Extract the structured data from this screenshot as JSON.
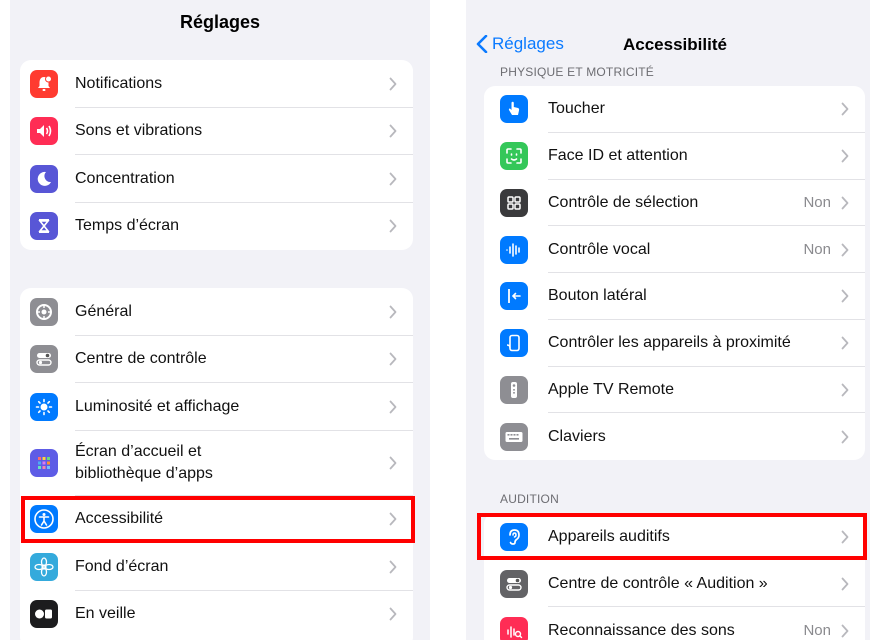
{
  "left": {
    "title": "Réglages",
    "group1": [
      {
        "label": "Notifications",
        "icon": "notifications-bell-icon",
        "color": "#ff3b30"
      },
      {
        "label": "Sons et vibrations",
        "icon": "speaker-sound-icon",
        "color": "#ff2d55"
      },
      {
        "label": "Concentration",
        "icon": "moon-icon",
        "color": "#5856d6"
      },
      {
        "label": "Temps d’écran",
        "icon": "hourglass-icon",
        "color": "#5856d6"
      }
    ],
    "group2": [
      {
        "label": "Général",
        "icon": "gear-icon",
        "color": "#8e8e93"
      },
      {
        "label": "Centre de contrôle",
        "icon": "toggles-icon",
        "color": "#8e8e93"
      },
      {
        "label": "Luminosité et affichage",
        "icon": "sun-icon",
        "color": "#007aff"
      },
      {
        "label": "Écran d’accueil et",
        "label2": "bibliothèque d’apps",
        "icon": "app-grid-icon",
        "color": "#5e5ce6"
      },
      {
        "label": "Accessibilité",
        "icon": "accessibility-person-icon",
        "color": "#007aff",
        "highlighted": true
      },
      {
        "label": "Fond d’écran",
        "icon": "flower-icon",
        "color": "#34aadc"
      },
      {
        "label": "En veille",
        "icon": "standby-icon",
        "color": "#1c1c1e"
      }
    ]
  },
  "right": {
    "back_label": "Réglages",
    "title": "Accessibilité",
    "section1": "PHYSIQUE ET MOTRICITÉ",
    "group1": [
      {
        "label": "Toucher",
        "icon": "hand-touch-icon",
        "color": "#007aff"
      },
      {
        "label": "Face ID et attention",
        "icon": "face-id-icon",
        "color": "#34c759"
      },
      {
        "label": "Contrôle de sélection",
        "value": "Non",
        "icon": "switch-grid-icon",
        "color": "#3a3a3c"
      },
      {
        "label": "Contrôle vocal",
        "value": "Non",
        "icon": "voice-wave-icon",
        "color": "#007aff"
      },
      {
        "label": "Bouton latéral",
        "icon": "side-button-icon",
        "color": "#007aff"
      },
      {
        "label": "Contrôler les appareils à proximité",
        "icon": "nearby-device-icon",
        "color": "#007aff"
      },
      {
        "label": "Apple TV Remote",
        "icon": "tv-remote-icon",
        "color": "#8e8e93"
      },
      {
        "label": "Claviers",
        "icon": "keyboard-icon",
        "color": "#8e8e93"
      }
    ],
    "section2": "AUDITION",
    "group2": [
      {
        "label": "Appareils auditifs",
        "icon": "ear-icon",
        "color": "#007aff",
        "highlighted": true
      },
      {
        "label": "Centre de contrôle « Audition »",
        "icon": "toggles-icon",
        "color": "#636366"
      },
      {
        "label": "Reconnaissance des sons",
        "value": "Non",
        "icon": "sound-recognition-icon",
        "color": "#ff2d55"
      }
    ]
  },
  "colors": {
    "highlight": "#ff0000",
    "accent": "#0a7aff",
    "background": "#f2f2f7"
  }
}
